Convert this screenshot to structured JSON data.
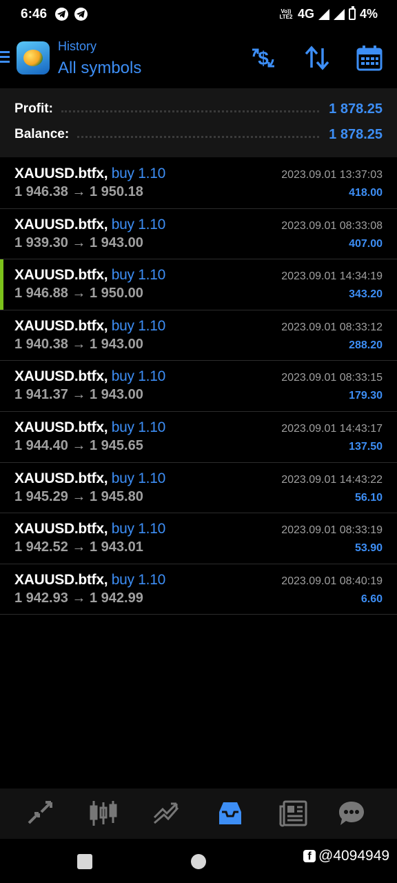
{
  "status_bar": {
    "time": "6:46",
    "network": "4G",
    "volte": "Vo)) LTE2",
    "battery": "4%"
  },
  "header": {
    "section": "History",
    "filter": "All symbols",
    "icons": [
      "menu-icon",
      "mt-logo-icon",
      "currency-exchange-icon",
      "sort-icon",
      "calendar-icon"
    ]
  },
  "summary": {
    "profit_label": "Profit:",
    "profit_value": "1 878.25",
    "balance_label": "Balance:",
    "balance_value": "1 878.25"
  },
  "trades": [
    {
      "symbol": "XAUUSD.btfx,",
      "side": "buy 1.10",
      "prices": "1 946.38 → 1 950.18",
      "datetime": "2023.09.01 13:37:03",
      "profit": "418.00",
      "selected": false
    },
    {
      "symbol": "XAUUSD.btfx,",
      "side": "buy 1.10",
      "prices": "1 939.30 → 1 943.00",
      "datetime": "2023.09.01 08:33:08",
      "profit": "407.00",
      "selected": false
    },
    {
      "symbol": "XAUUSD.btfx,",
      "side": "buy 1.10",
      "prices": "1 946.88 → 1 950.00",
      "datetime": "2023.09.01 14:34:19",
      "profit": "343.20",
      "selected": true
    },
    {
      "symbol": "XAUUSD.btfx,",
      "side": "buy 1.10",
      "prices": "1 940.38 → 1 943.00",
      "datetime": "2023.09.01 08:33:12",
      "profit": "288.20",
      "selected": false
    },
    {
      "symbol": "XAUUSD.btfx,",
      "side": "buy 1.10",
      "prices": "1 941.37 → 1 943.00",
      "datetime": "2023.09.01 08:33:15",
      "profit": "179.30",
      "selected": false
    },
    {
      "symbol": "XAUUSD.btfx,",
      "side": "buy 1.10",
      "prices": "1 944.40 → 1 945.65",
      "datetime": "2023.09.01 14:43:17",
      "profit": "137.50",
      "selected": false
    },
    {
      "symbol": "XAUUSD.btfx,",
      "side": "buy 1.10",
      "prices": "1 945.29 → 1 945.80",
      "datetime": "2023.09.01 14:43:22",
      "profit": "56.10",
      "selected": false
    },
    {
      "symbol": "XAUUSD.btfx,",
      "side": "buy 1.10",
      "prices": "1 942.52 → 1 943.01",
      "datetime": "2023.09.01 08:33:19",
      "profit": "53.90",
      "selected": false
    },
    {
      "symbol": "XAUUSD.btfx,",
      "side": "buy 1.10",
      "prices": "1 942.93 → 1 942.99",
      "datetime": "2023.09.01 08:40:19",
      "profit": "6.60",
      "selected": false
    }
  ],
  "bottom_nav": {
    "items": [
      "quotes-icon",
      "chart-icon",
      "trade-icon",
      "history-icon",
      "news-icon",
      "messages-icon"
    ],
    "active": "history-icon"
  },
  "watermark": "@4094949",
  "colors": {
    "accent": "#3d8ef5",
    "selected_marker": "#7cc21b",
    "muted_text": "#a0a0a0"
  }
}
